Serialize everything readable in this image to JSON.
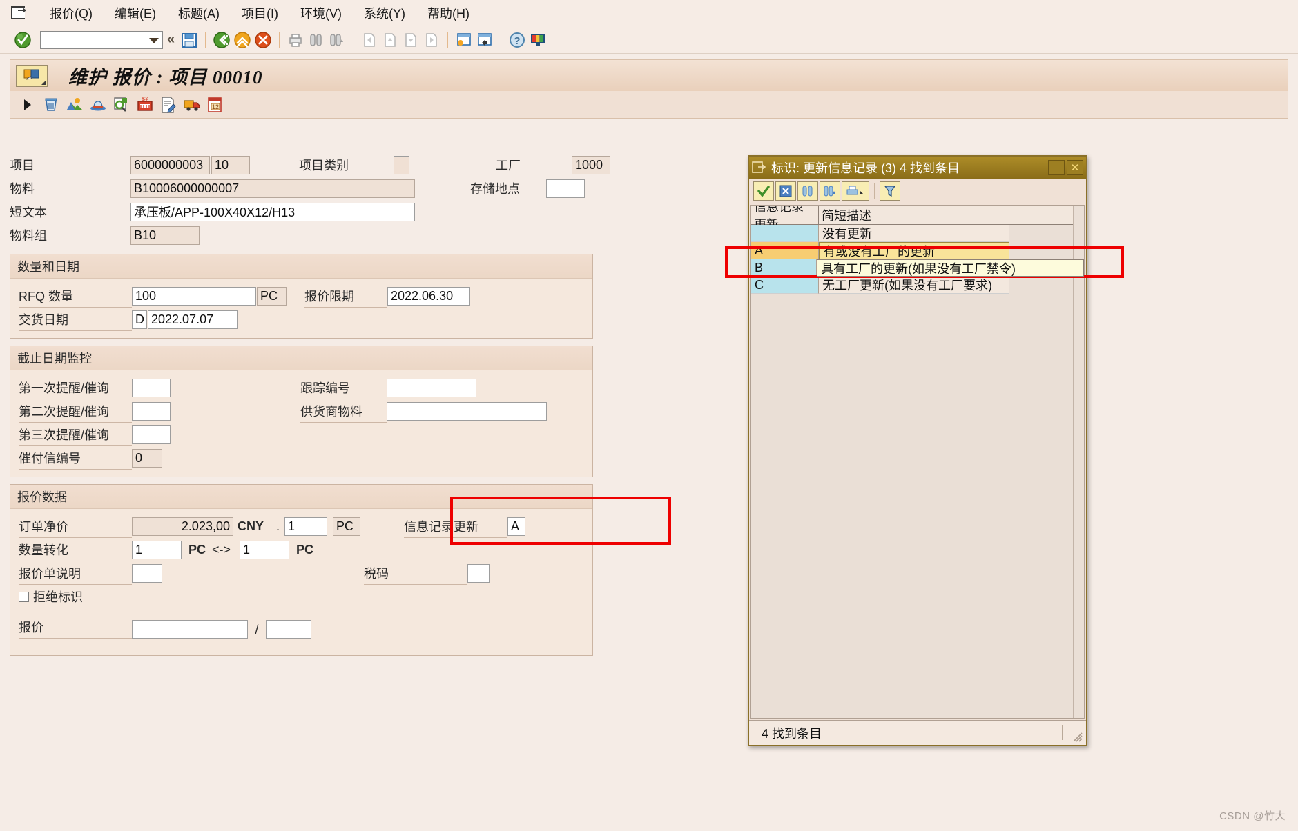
{
  "menu": {
    "items": [
      {
        "label": "报价(Q)",
        "key": "Q"
      },
      {
        "label": "编辑(E)",
        "key": "E"
      },
      {
        "label": "标题(A)",
        "key": "A"
      },
      {
        "label": "项目(I)",
        "key": "I"
      },
      {
        "label": "环境(V)",
        "key": "V"
      },
      {
        "label": "系统(Y)",
        "key": "Y"
      },
      {
        "label": "帮助(H)",
        "key": "H"
      }
    ]
  },
  "toolbar": {
    "command_value": "",
    "command_placeholder": "",
    "icons": [
      "enter-check-icon",
      "command-dropdown-icon",
      "collapse-icon",
      "save-icon",
      "back-icon",
      "exit-icon",
      "cancel-icon",
      "print-icon",
      "find-icon",
      "find-next-icon",
      "first-page-icon",
      "previous-page-icon",
      "next-page-icon",
      "last-page-icon",
      "create-session-icon",
      "create-shortcut-icon",
      "help-icon",
      "customize-layout-icon"
    ]
  },
  "title": {
    "text": "维护 报价 : 项目 00010",
    "icon": "transaction-icon"
  },
  "apptoolbar": {
    "icons": [
      "expand-arrow-icon",
      "delete-icon",
      "overview-icon",
      "header-icon",
      "search-details-icon",
      "conditions-icon",
      "texts-icon",
      "delivery-icon",
      "schedule-icon"
    ]
  },
  "form": {
    "item": {
      "label": "项目",
      "doc_number": "6000000003",
      "item_number": "10"
    },
    "item_category": {
      "label": "项目类别",
      "value": ""
    },
    "plant": {
      "label": "工厂",
      "value": "1000"
    },
    "material": {
      "label": "物料",
      "value": "B10006000000007"
    },
    "storage_location": {
      "label": "存储地点",
      "value": ""
    },
    "short_text": {
      "label": "短文本",
      "value": "承压板/APP-100X40X12/H13"
    },
    "material_group": {
      "label": "物料组",
      "value": "B10"
    },
    "qty_date_group": {
      "title": "数量和日期",
      "rfq_quantity": {
        "label": "RFQ 数量",
        "value": "100",
        "unit": "PC"
      },
      "quotation_deadline": {
        "label": "报价限期",
        "value": "2022.06.30"
      },
      "delivery_date": {
        "label": "交货日期",
        "category": "D",
        "value": "2022.07.07"
      }
    },
    "deadline_group": {
      "title": "截止日期监控",
      "reminder1": {
        "label": "第一次提醒/催询",
        "value": ""
      },
      "reminder2": {
        "label": "第二次提醒/催询",
        "value": ""
      },
      "reminder3": {
        "label": "第三次提醒/催询",
        "value": ""
      },
      "dunning_number": {
        "label": "催付信编号",
        "value": "0"
      },
      "tracking_number": {
        "label": "跟踪编号",
        "value": ""
      },
      "vendor_material": {
        "label": "供货商物料",
        "value": ""
      }
    },
    "quote_group": {
      "title": "报价数据",
      "net_price": {
        "label": "订单净价",
        "value": "2.023,00",
        "currency": "CNY",
        "per_sep": ".",
        "per": "1",
        "unit": "PC"
      },
      "qty_conversion": {
        "label": "数量转化",
        "value1": "1",
        "unit1": "PC",
        "arrow": "<->",
        "value2": "1",
        "unit2": "PC"
      },
      "quotation_note": {
        "label": "报价单说明",
        "value": ""
      },
      "rejection_indicator": {
        "label": "拒绝标识",
        "checked": false
      },
      "info_record_update": {
        "label": "信息记录更新",
        "value": "A"
      },
      "tax_code": {
        "label": "税码",
        "value": ""
      },
      "quotation": {
        "label": "报价",
        "value1": "",
        "separator": "/",
        "value2": ""
      }
    }
  },
  "dialog": {
    "title": "标识: 更新信息记录 (3)   4 找到条目",
    "title_icon": "dialog-icon",
    "window_buttons": [
      "minimize-button",
      "close-button"
    ],
    "toolbar_icons": [
      "accept-icon",
      "cancel-icon",
      "find-icon",
      "find-next-icon",
      "print-icon",
      "personal-list-icon"
    ],
    "columns": [
      "信息记录更新",
      "简短描述"
    ],
    "rows": [
      {
        "key": "",
        "desc": "没有更新",
        "selected": false,
        "highlight": false
      },
      {
        "key": "A",
        "desc": "有或没有工厂的更新",
        "selected": true,
        "highlight": false
      },
      {
        "key": "B",
        "desc": "具有工厂的更新(如果没有工厂禁令)",
        "selected": false,
        "highlight": true
      },
      {
        "key": "C",
        "desc": "无工厂更新(如果没有工厂要求)",
        "selected": false,
        "highlight": false
      }
    ],
    "status": "4 找到条目"
  },
  "watermark": "CSDN @竹大",
  "colors": {
    "accent": "#8a6d18",
    "annotation": "#ee0000",
    "selection": "#f7d27a",
    "key_column": "#b8e3ec",
    "form_bg": "#f0e0d4"
  }
}
